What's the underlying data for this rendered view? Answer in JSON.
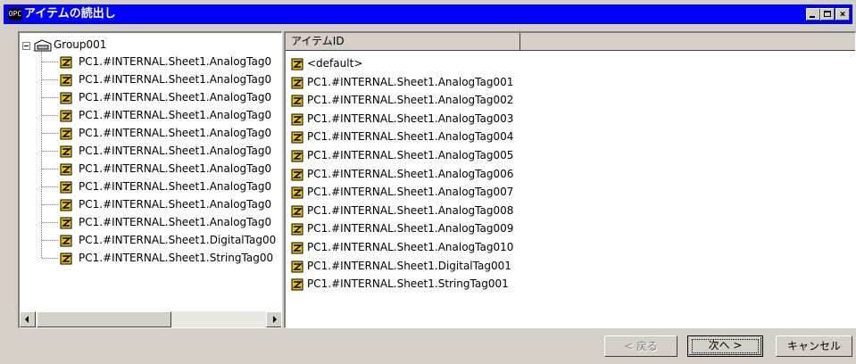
{
  "window": {
    "icon_text": "OPC",
    "title": "アイテムの読出し",
    "buttons": {
      "minimize": "_",
      "maximize": "□",
      "close": "×"
    }
  },
  "tree": {
    "root": {
      "label": "Group001",
      "expander": "-",
      "icon": "group-folder-icon"
    },
    "items": [
      {
        "label": "PC1.#INTERNAL.Sheet1.AnalogTag0"
      },
      {
        "label": "PC1.#INTERNAL.Sheet1.AnalogTag0"
      },
      {
        "label": "PC1.#INTERNAL.Sheet1.AnalogTag0"
      },
      {
        "label": "PC1.#INTERNAL.Sheet1.AnalogTag0"
      },
      {
        "label": "PC1.#INTERNAL.Sheet1.AnalogTag0"
      },
      {
        "label": "PC1.#INTERNAL.Sheet1.AnalogTag0"
      },
      {
        "label": "PC1.#INTERNAL.Sheet1.AnalogTag0"
      },
      {
        "label": "PC1.#INTERNAL.Sheet1.AnalogTag0"
      },
      {
        "label": "PC1.#INTERNAL.Sheet1.AnalogTag0"
      },
      {
        "label": "PC1.#INTERNAL.Sheet1.AnalogTag0"
      },
      {
        "label": "PC1.#INTERNAL.Sheet1.DigitalTag00"
      },
      {
        "label": "PC1.#INTERNAL.Sheet1.StringTag00"
      }
    ],
    "item_icon": "tag-icon"
  },
  "list": {
    "column_header": "アイテムID",
    "items": [
      {
        "label": "<default>"
      },
      {
        "label": "PC1.#INTERNAL.Sheet1.AnalogTag001"
      },
      {
        "label": "PC1.#INTERNAL.Sheet1.AnalogTag002"
      },
      {
        "label": "PC1.#INTERNAL.Sheet1.AnalogTag003"
      },
      {
        "label": "PC1.#INTERNAL.Sheet1.AnalogTag004"
      },
      {
        "label": "PC1.#INTERNAL.Sheet1.AnalogTag005"
      },
      {
        "label": "PC1.#INTERNAL.Sheet1.AnalogTag006"
      },
      {
        "label": "PC1.#INTERNAL.Sheet1.AnalogTag007"
      },
      {
        "label": "PC1.#INTERNAL.Sheet1.AnalogTag008"
      },
      {
        "label": "PC1.#INTERNAL.Sheet1.AnalogTag009"
      },
      {
        "label": "PC1.#INTERNAL.Sheet1.AnalogTag010"
      },
      {
        "label": "PC1.#INTERNAL.Sheet1.DigitalTag001"
      },
      {
        "label": "PC1.#INTERNAL.Sheet1.StringTag001"
      }
    ]
  },
  "footer": {
    "back_label": "< 戻る",
    "next_label": "次へ >",
    "cancel_label": "キャンセル"
  },
  "colors": {
    "title_bar": "#0000ff",
    "face": "#d4d0c8",
    "icon_yellow": "#e8c800"
  }
}
